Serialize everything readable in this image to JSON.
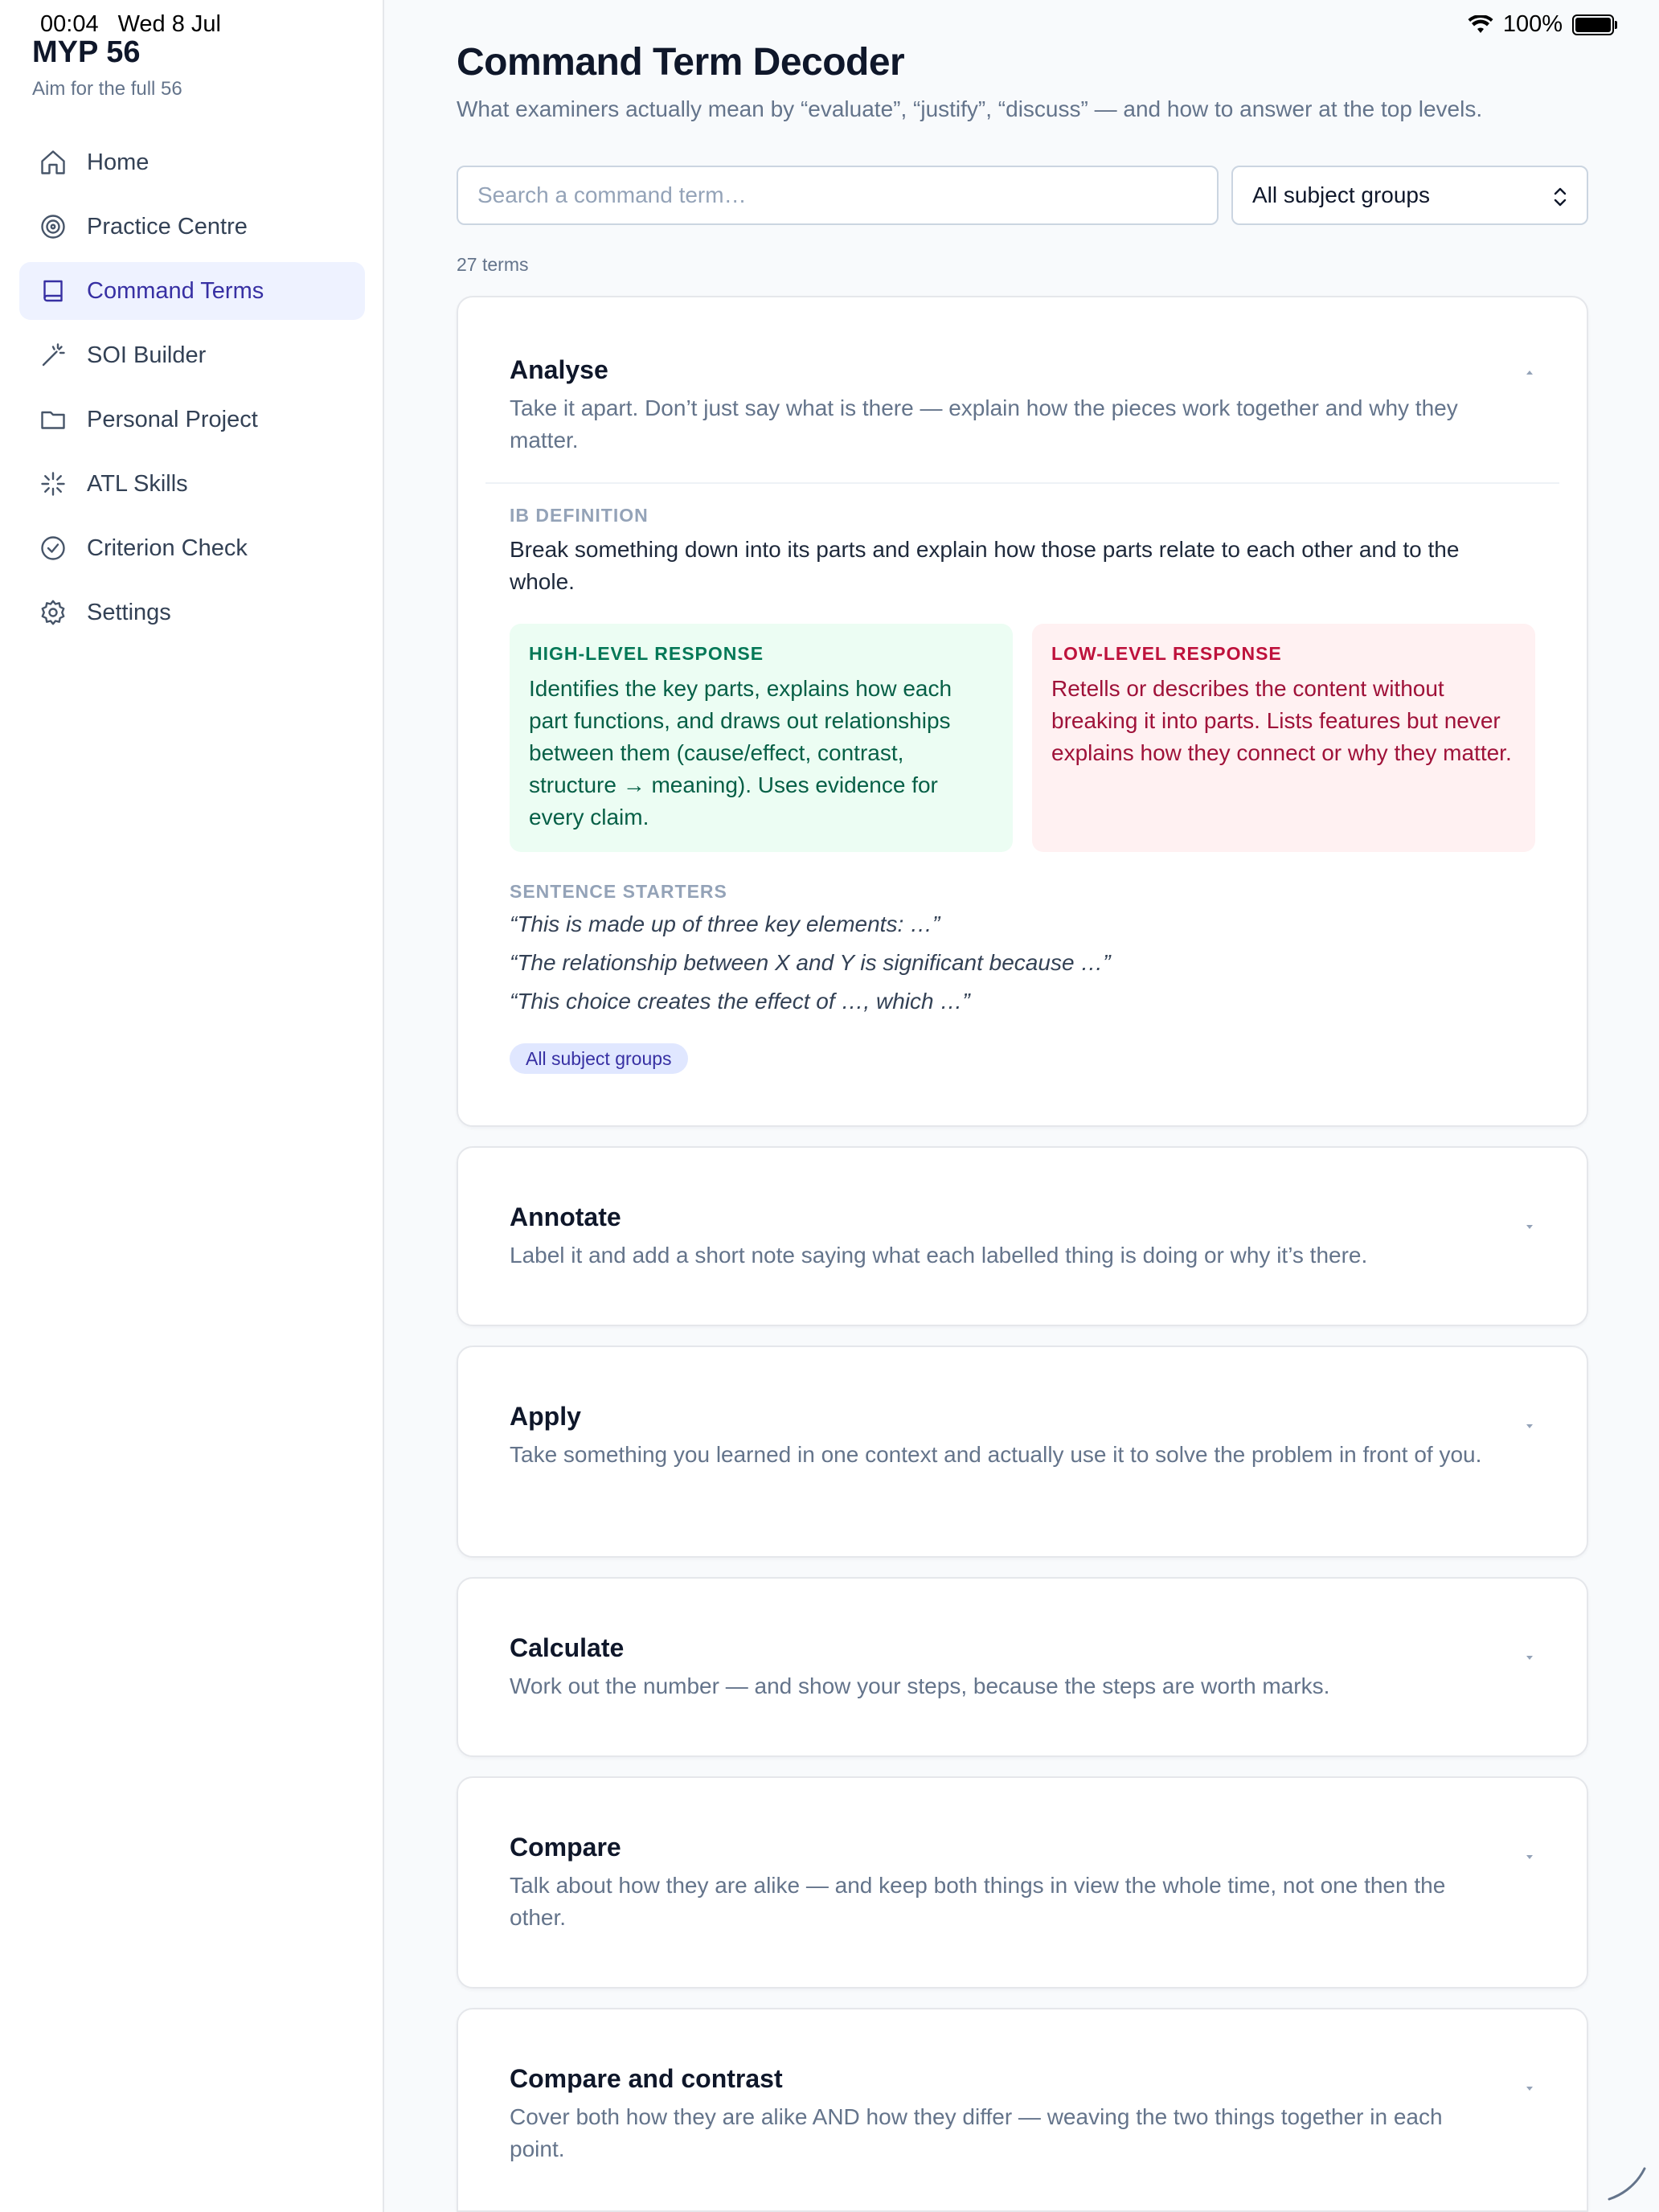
{
  "status_bar": {
    "time": "00:04",
    "date": "Wed 8 Jul",
    "battery": "100%"
  },
  "sidebar": {
    "brand": "MYP 56",
    "tagline": "Aim for the full 56",
    "items": [
      {
        "label": "Home",
        "icon": "home-icon"
      },
      {
        "label": "Practice Centre",
        "icon": "target-icon"
      },
      {
        "label": "Command Terms",
        "icon": "book-icon",
        "active": true
      },
      {
        "label": "SOI Builder",
        "icon": "wand-icon"
      },
      {
        "label": "Personal Project",
        "icon": "folder-icon"
      },
      {
        "label": "ATL Skills",
        "icon": "sparkle-icon"
      },
      {
        "label": "Criterion Check",
        "icon": "check-circle-icon"
      },
      {
        "label": "Settings",
        "icon": "gear-icon"
      }
    ]
  },
  "header": {
    "title": "Command Term Decoder",
    "subtitle": "What examiners actually mean by “evaluate”, “justify”, “discuss” — and how to answer at the top levels."
  },
  "search": {
    "placeholder": "Search a command term…",
    "value": ""
  },
  "filter": {
    "selected": "All subject groups"
  },
  "count_text": "27 terms",
  "terms": [
    {
      "term": "Analyse",
      "summary": "Take it apart. Don’t just say what is there — explain how the pieces work together and why they matter.",
      "expanded": true,
      "definition_label": "IB DEFINITION",
      "definition": "Break something down into its parts and explain how those parts relate to each other and to the whole.",
      "high_label": "HIGH-LEVEL RESPONSE",
      "high": "Identifies the key parts, explains how each part functions, and draws out relationships between them (cause/effect, contrast, structure → meaning). Uses evidence for every claim.",
      "low_label": "LOW-LEVEL RESPONSE",
      "low": "Retells or describes the content without breaking it into parts. Lists features but never explains how they connect or why they matter.",
      "starters_label": "SENTENCE STARTERS",
      "starters": [
        "“This is made up of three key elements: …”",
        "“The relationship between X and Y is significant because …”",
        "“This choice creates the effect of …, which …”"
      ],
      "tag": "All subject groups"
    },
    {
      "term": "Annotate",
      "summary": "Label it and add a short note saying what each labelled thing is doing or why it’s there.",
      "expanded": false
    },
    {
      "term": "Apply",
      "summary": "Take something you learned in one context and actually use it to solve the problem in front of you.",
      "expanded": false
    },
    {
      "term": "Calculate",
      "summary": "Work out the number — and show your steps, because the steps are worth marks.",
      "expanded": false
    },
    {
      "term": "Compare",
      "summary": "Talk about how they are alike — and keep both things in view the whole time, not one then the other.",
      "expanded": false
    },
    {
      "term": "Compare and contrast",
      "summary": "Cover both how they are alike AND how they differ — weaving the two things together in each point.",
      "expanded": false
    }
  ],
  "colors": {
    "accent": "#3730a3",
    "accent_bg": "#eef2ff",
    "high_bg": "#ecfdf3",
    "low_bg": "#fff1f2"
  }
}
